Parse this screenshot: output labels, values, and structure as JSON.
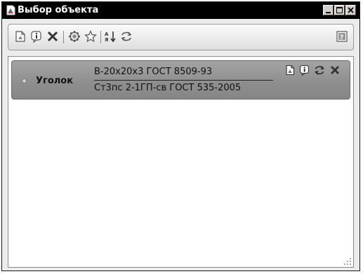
{
  "window": {
    "title": "Выбор объекта",
    "controls": [
      "minimize-icon",
      "maximize-icon",
      "close-icon"
    ]
  },
  "toolbar": {
    "buttons": [
      "open-document-icon",
      "info-icon",
      "delete-icon",
      "refresh-object-icon",
      "favorite-star-icon",
      "sort-icon",
      "replace-icon",
      "help-icon"
    ]
  },
  "list": {
    "items": [
      {
        "name": "Уголок",
        "line1": "B-20х20х3 ГОСТ 8509-93",
        "line2": "Ст3пс 2-1ГП-св ГОСТ 535-2005",
        "actions": [
          "open-document-icon",
          "info-icon",
          "replace-icon",
          "delete-icon"
        ]
      }
    ]
  }
}
